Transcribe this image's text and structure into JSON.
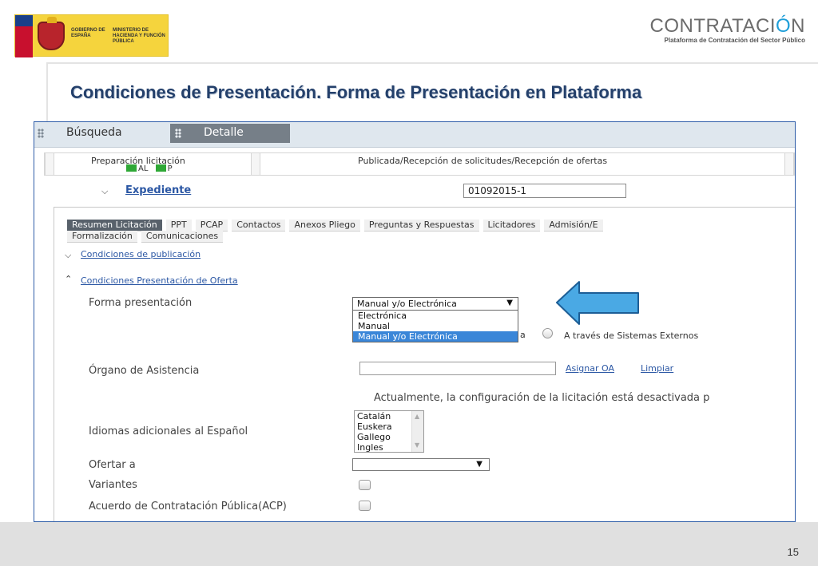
{
  "header": {
    "gov_logo": {
      "line1": "GOBIERNO DE ESPAÑA",
      "line2": "MINISTERIO DE HACIENDA Y FUNCIÓN PÚBLICA"
    },
    "brand": {
      "name_prefix": "CONTRATACI",
      "name_power": "Ó",
      "name_suffix": "N",
      "subtitle": "Plataforma de Contratación del Sector Público"
    }
  },
  "slide_title": "Condiciones de Presentación. Forma de Presentación en Plataforma",
  "screen": {
    "tabs": {
      "busqueda": "Búsqueda",
      "detalle": "Detalle"
    },
    "stages": {
      "preparacion": "Preparación licitación",
      "publicada": "Publicada/Recepción de solicitudes/Recepción de ofertas",
      "legend_al": "AL",
      "legend_p": "P",
      "legend_color": "#2fa836"
    },
    "expediente": {
      "label": "Expediente",
      "value": "01092015-1"
    },
    "subtabs_row1": [
      "Resumen Licitación",
      "PPT",
      "PCAP",
      "Contactos",
      "Anexos Pliego",
      "Preguntas y Respuestas",
      "Licitadores",
      "Admisión/E"
    ],
    "subtabs_row2": [
      "Formalización",
      "Comunicaciones"
    ],
    "sections": {
      "publicacion": "Condiciones de publicación",
      "presentacion": "Condiciones Presentación de Oferta"
    },
    "forma_presentacion": {
      "label": "Forma presentación",
      "selected": "Manual y/o Electrónica",
      "options": [
        "Electrónica",
        "Manual",
        "Manual y/o Electrónica"
      ],
      "partial_text": "a",
      "radio_external": "A través de Sistemas Externos"
    },
    "organo_asistencia": {
      "label": "Órgano de Asistencia",
      "value": "",
      "assign_link": "Asignar OA",
      "clear_link": "Limpiar"
    },
    "info_text": "Actualmente, la configuración de la licitación está desactivada p",
    "idiomas": {
      "label": "Idiomas adicionales al Español",
      "options": [
        "Catalán",
        "Euskera",
        "Gallego",
        "Ingles"
      ]
    },
    "ofertar_a": {
      "label": "Ofertar a",
      "value": ""
    },
    "variantes": {
      "label": "Variantes",
      "checked": false
    },
    "acp": {
      "label": "Acuerdo de Contratación Pública(ACP)",
      "checked": false
    }
  },
  "footer": {
    "page_number": "15"
  }
}
